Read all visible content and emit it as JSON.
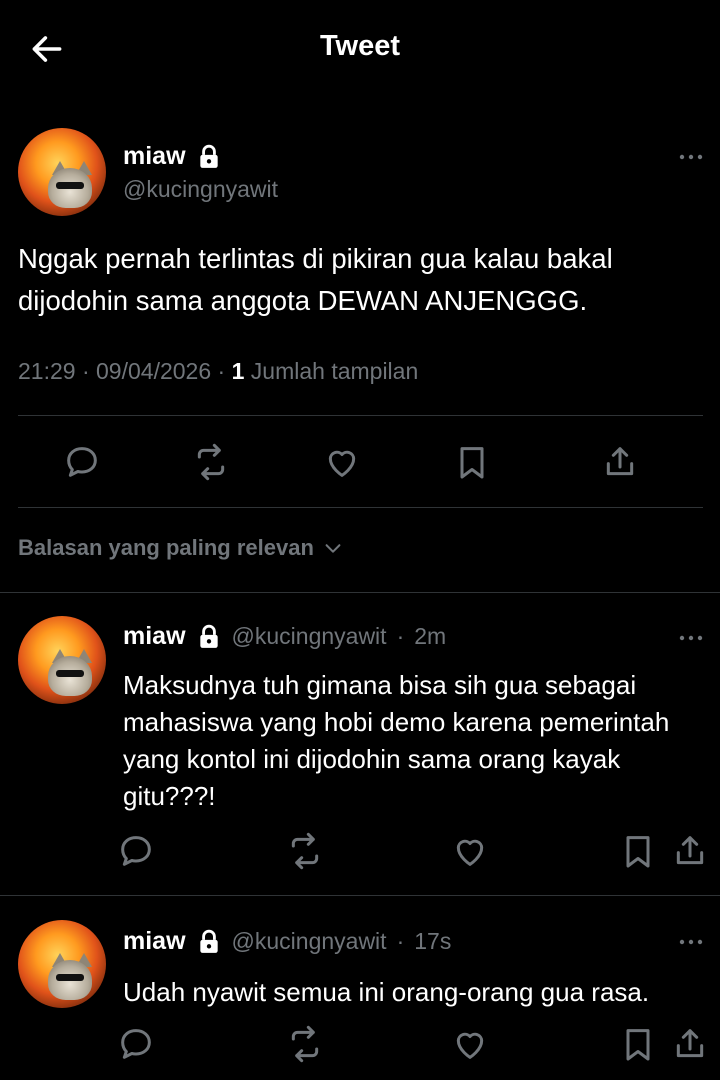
{
  "header": {
    "title": "Tweet"
  },
  "main_tweet": {
    "display_name": "miaw",
    "handle": "@kucingnyawit",
    "text": "Nggak pernah terlintas di pikiran gua kalau bakal dijodohin sama anggota DEWAN ANJENGGG.",
    "time": "21:29",
    "date": "09/04/2026",
    "views_count": "1",
    "views_label": "Jumlah tampilan"
  },
  "sort": {
    "label": "Balasan yang paling relevan"
  },
  "replies": [
    {
      "display_name": "miaw",
      "handle": "@kucingnyawit",
      "time": "2m",
      "text": "Maksudnya tuh gimana bisa sih gua sebagai mahasiswa yang hobi demo karena pemerintah yang kontol ini dijodohin sama orang kayak gitu???!"
    },
    {
      "display_name": "miaw",
      "handle": "@kucingnyawit",
      "time": "17s",
      "text": "Udah nyawit semua ini orang-orang gua rasa."
    }
  ],
  "colors": {
    "background": "#000000",
    "text": "#e7e9ea",
    "muted": "#71767b",
    "divider": "#2f3336"
  },
  "icons": [
    "back-arrow-icon",
    "lock-icon",
    "more-icon",
    "reply-icon",
    "retweet-icon",
    "like-icon",
    "bookmark-icon",
    "share-icon",
    "chevron-down-icon"
  ]
}
